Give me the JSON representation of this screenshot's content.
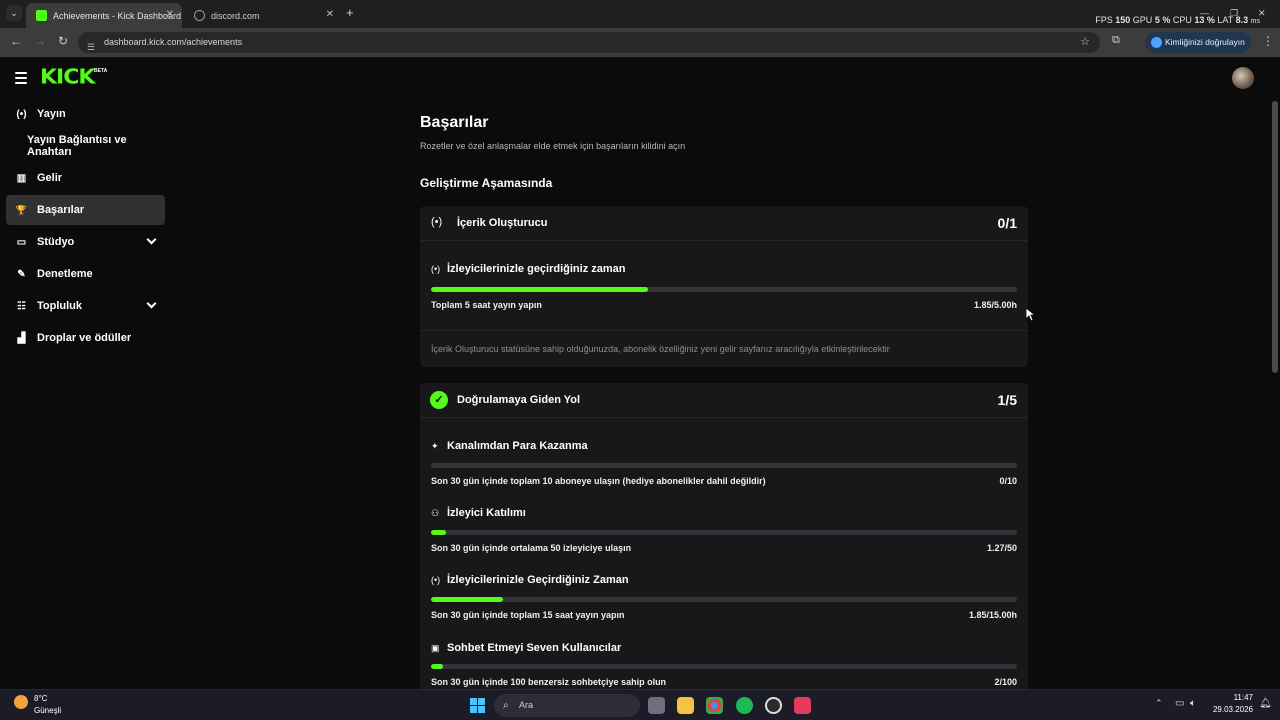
{
  "browser": {
    "tabs": [
      {
        "title": "Achievements - Kick Dashboard",
        "active": true,
        "favicon_color": "#53fc18"
      },
      {
        "title": "discord.com",
        "active": false,
        "favicon_color": "#8a8a8a"
      }
    ],
    "new_tab": "+",
    "perf": {
      "fps_label": "FPS",
      "fps": "150",
      "gpu_label": "GPU",
      "gpu": "5 %",
      "cpu_label": "CPU",
      "cpu": "13 %",
      "lat_label": "LAT",
      "lat": "8.3",
      "lat_unit": "ms"
    },
    "url": "dashboard.kick.com/achievements",
    "verify_button": "Kimliğinizi doğrulayın"
  },
  "app": {
    "logo": "KICK",
    "logo_badge": "BETA",
    "sidebar": [
      {
        "label": "Yayın",
        "icon": "broadcast-icon",
        "glyph": "(•)"
      },
      {
        "label": "Yayın Bağlantısı ve Anahtarı",
        "icon": "",
        "glyph": ""
      },
      {
        "label": "Gelir",
        "icon": "chart-icon",
        "glyph": "▥"
      },
      {
        "label": "Başarılar",
        "icon": "trophy-icon",
        "glyph": "🏆",
        "active": true
      },
      {
        "label": "Stüdyo",
        "icon": "studio-icon",
        "glyph": "▭",
        "expandable": true
      },
      {
        "label": "Denetleme",
        "icon": "wrench-icon",
        "glyph": "✎"
      },
      {
        "label": "Topluluk",
        "icon": "community-icon",
        "glyph": "☷",
        "expandable": true
      },
      {
        "label": "Droplar ve ödüller",
        "icon": "drops-icon",
        "glyph": "▟"
      }
    ]
  },
  "page": {
    "title": "Başarılar",
    "subtitle": "Rozetler ve özel anlaşmalar elde etmek için başarıların kilidini açın",
    "section_title": "Geliştirme Aşamasında",
    "cards": [
      {
        "title": "İçerik Oluşturucu",
        "count": "0/1",
        "icon": "broadcast-icon",
        "achievements": [
          {
            "title": "İzleyicilerinizle geçirdiğiniz zaman",
            "icon": "broadcast-icon",
            "description": "Toplam 5 saat yayın yapın",
            "value": "1.85/5.00h",
            "progress": 0.37
          }
        ],
        "note": "İçerik Oluşturucu statüsüne sahip olduğunuzda, abonelik özelliğiniz yeni gelir sayfanız aracılığıyla etkinleştirilecektir"
      },
      {
        "title": "Doğrulamaya Giden Yol",
        "count": "1/5",
        "icon": "verified-badge-icon",
        "achievements": [
          {
            "title": "Kanalımdan Para Kazanma",
            "icon": "sparkle-icon",
            "description": "Son 30 gün içinde toplam 10 aboneye ulaşın (hediye abonelikler dahil değildir)",
            "value": "0/10",
            "progress": 0.0
          },
          {
            "title": "İzleyici Katılımı",
            "icon": "people-icon",
            "description": "Son 30 gün içinde ortalama 50 izleyiciye ulaşın",
            "value": "1.27/50",
            "progress": 0.025
          },
          {
            "title": "İzleyicilerinizle Geçirdiğiniz Zaman",
            "icon": "broadcast-icon",
            "description": "Son 30 gün içinde toplam 15 saat yayın yapın",
            "value": "1.85/15.00h",
            "progress": 0.123
          },
          {
            "title": "Sohbet Etmeyi Seven Kullanıcılar",
            "icon": "chat-icon",
            "description": "Son 30 gün içinde 100 benzersiz sohbetçiye sahip olun",
            "value": "2/100",
            "progress": 0.02
          }
        ]
      }
    ]
  },
  "taskbar": {
    "weather_temp": "8°C",
    "weather_desc": "Güneşli",
    "search_placeholder": "Ara",
    "time": "11:47",
    "date": "29.03.2026"
  }
}
